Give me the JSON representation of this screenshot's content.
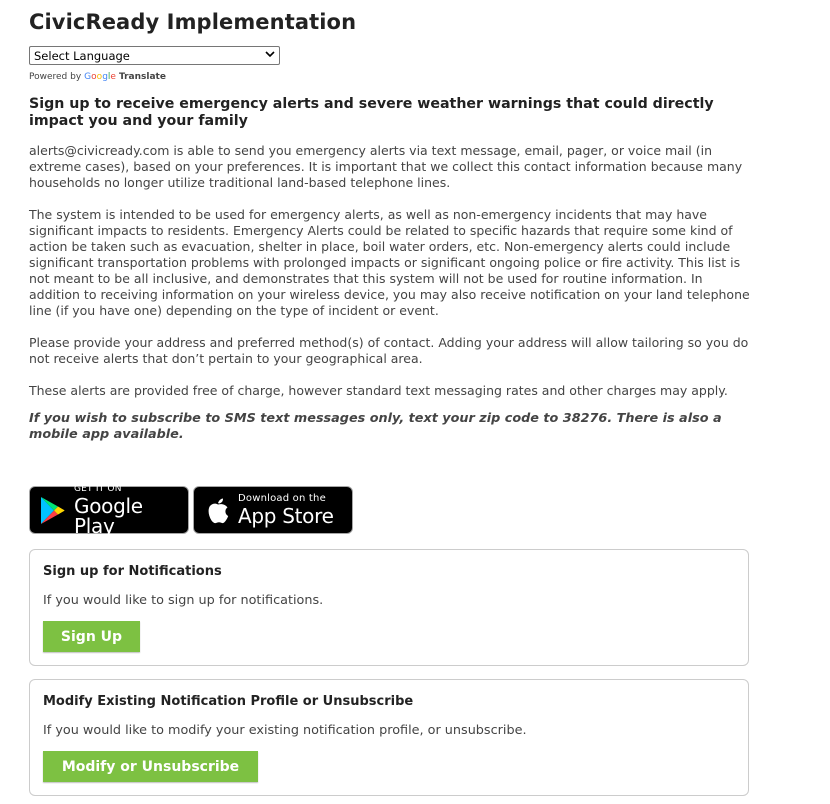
{
  "page": {
    "title": "CivicReady Implementation"
  },
  "translate": {
    "select_label": "Select Language",
    "powered_by": "Powered by",
    "google_letters": [
      "G",
      "o",
      "o",
      "g",
      "l",
      "e"
    ],
    "translate_word": "Translate"
  },
  "intro": {
    "heading": "Sign up to receive emergency alerts and severe weather warnings that could directly impact you and your family",
    "paragraph1": "alerts@civicready.com is able to send you emergency alerts via text message, email, pager, or voice mail (in extreme cases), based on your preferences. It is important that we collect this contact information because many households no longer utilize traditional land-based telephone lines.",
    "paragraph2": "The system is intended to be used for emergency alerts, as well as non-emergency incidents that may have significant impacts to residents. Emergency Alerts could be related to specific hazards that require some kind of action be taken such as evacuation, shelter in place, boil water orders, etc. Non-emergency alerts could include significant transportation problems with prolonged impacts or significant ongoing police or fire activity. This list is not meant to be all inclusive, and demonstrates that this system will not be used for routine information. In addition to receiving information on your wireless device, you may also receive notification on your land telephone line (if you have one) depending on the type of incident or event.",
    "paragraph3": "Please provide your address and preferred method(s) of contact. Adding your address will allow tailoring so you do not receive alerts that don’t pertain to your geographical area.",
    "paragraph4": "These alerts are provided free of charge, however standard text messaging rates and other charges may apply.",
    "sms_note": "If you wish to subscribe to SMS text messages only, text your zip code to 38276.  There is also a mobile app available."
  },
  "stores": {
    "google": {
      "small": "GET IT ON",
      "big": "Google Play",
      "icon": "google-play-icon"
    },
    "apple": {
      "small": "Download on the",
      "big": "App Store",
      "icon": "apple-icon"
    }
  },
  "signup_card": {
    "title": "Sign up for Notifications",
    "description": "If you would like to sign up for notifications.",
    "button": "Sign Up"
  },
  "modify_card": {
    "title": "Modify Existing Notification Profile or Unsubscribe",
    "description": "If you would like to modify your existing notification profile, or unsubscribe.",
    "button": "Modify or Unsubscribe"
  },
  "colors": {
    "button_green": "#7dc142",
    "card_border": "#cccccc",
    "text": "#444444"
  }
}
